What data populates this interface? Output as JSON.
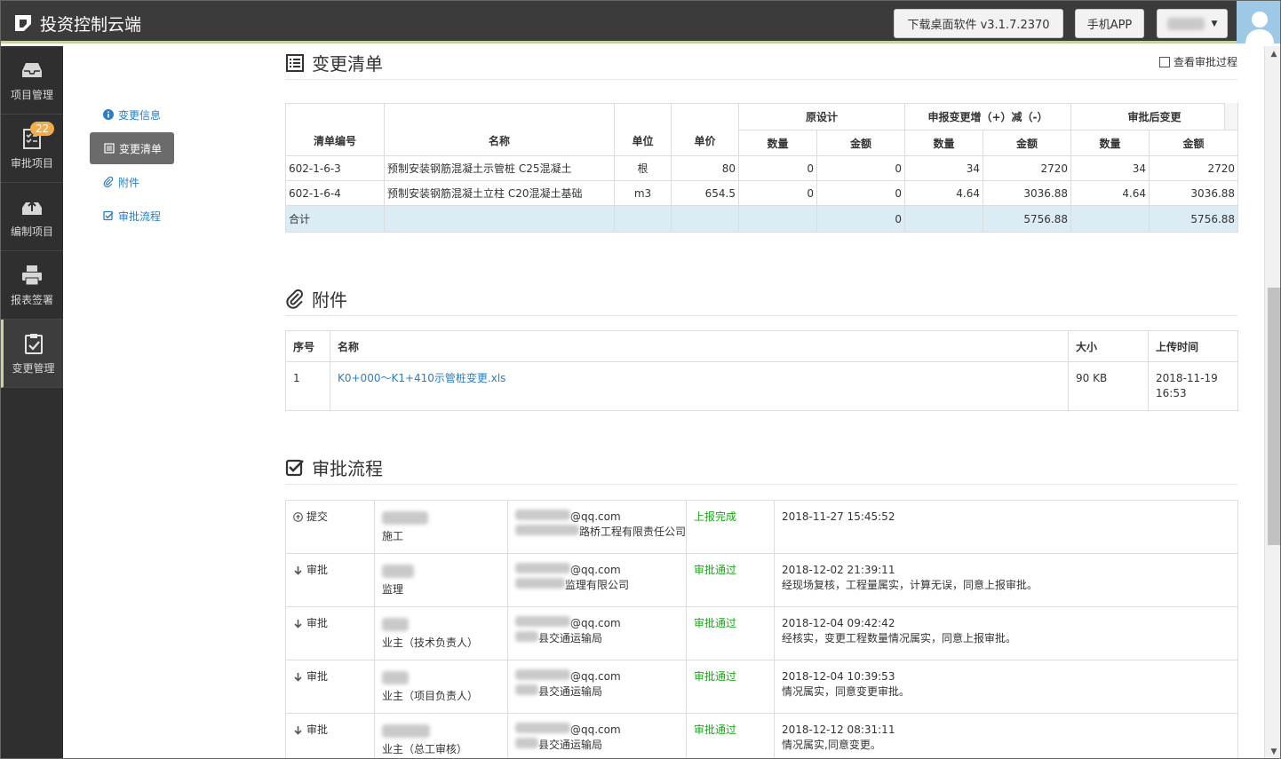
{
  "app": {
    "title": "投资控制云端"
  },
  "topbar": {
    "download_label": "下载桌面软件 v3.1.7.2370",
    "app_label": "手机APP"
  },
  "sidebar": {
    "items": [
      {
        "label": "项目管理",
        "icon": "inbox-icon"
      },
      {
        "label": "审批项目",
        "icon": "checklist-icon",
        "badge": "22"
      },
      {
        "label": "编制项目",
        "icon": "upload-icon"
      },
      {
        "label": "报表签署",
        "icon": "printer-icon"
      },
      {
        "label": "变更管理",
        "icon": "clipboard-icon",
        "active": true
      }
    ]
  },
  "subnav": {
    "items": [
      {
        "label": "变更信息"
      },
      {
        "label": "变更清单",
        "active": true
      },
      {
        "label": "附件"
      },
      {
        "label": "审批流程"
      }
    ]
  },
  "change_list": {
    "title": "变更清单",
    "view_process_label": "查看审批过程",
    "headers": {
      "code": "清单编号",
      "name": "名称",
      "unit": "单位",
      "price": "单价",
      "orig": "原设计",
      "report": "申报变更增（+）减（-）",
      "approved": "审批后变更",
      "qty": "数量",
      "amount": "金额"
    },
    "rows": [
      {
        "code": "602-1-6-3",
        "name": "预制安装钢筋混凝土示管桩 C25混凝土",
        "unit": "根",
        "price": "80",
        "orig_qty": "0",
        "orig_amt": "0",
        "rep_qty": "34",
        "rep_amt": "2720",
        "app_qty": "34",
        "app_amt": "2720"
      },
      {
        "code": "602-1-6-4",
        "name": "预制安装钢筋混凝土立柱 C20混凝土基础",
        "unit": "m3",
        "price": "654.5",
        "orig_qty": "0",
        "orig_amt": "0",
        "rep_qty": "4.64",
        "rep_amt": "3036.88",
        "app_qty": "4.64",
        "app_amt": "3036.88"
      }
    ],
    "total": {
      "label": "合计",
      "orig_amt": "0",
      "rep_amt": "5756.88",
      "app_amt": "5756.88"
    }
  },
  "attachments": {
    "title": "附件",
    "headers": {
      "no": "序号",
      "name": "名称",
      "size": "大小",
      "time": "上传时间"
    },
    "rows": [
      {
        "no": "1",
        "name": "K0+000～K1+410示管桩变更.xls",
        "size": "90 KB",
        "time": "2018-11-19 16:53"
      }
    ]
  },
  "process": {
    "title": "审批流程",
    "rows": [
      {
        "action": "提交",
        "role": "施工",
        "email": "@qq.com",
        "org": "路桥工程有限责任公司",
        "status": "上报完成",
        "time": "2018-11-27 15:45:52",
        "comment": ""
      },
      {
        "action": "审批",
        "role": "监理",
        "email": "@qq.com",
        "org": "监理有限公司",
        "status": "审批通过",
        "time": "2018-12-02 21:39:11",
        "comment": "经现场复核，工程量属实，计算无误，同意上报审批。"
      },
      {
        "action": "审批",
        "role": "业主（技术负责人）",
        "email": "@qq.com",
        "org": "县交通运输局",
        "status": "审批通过",
        "time": "2018-12-04 09:42:42",
        "comment": "经核实，变更工程数量情况属实，同意上报审批。"
      },
      {
        "action": "审批",
        "role": "业主（项目负责人）",
        "email": "@qq.com",
        "org": "县交通运输局",
        "status": "审批通过",
        "time": "2018-12-04 10:39:53",
        "comment": "情况属实，同意变更审批。"
      },
      {
        "action": "审批",
        "role": "业主（总工审核）",
        "email": "@qq.com",
        "org": "县交通运输局",
        "status": "审批通过",
        "time": "2018-12-12 08:31:11",
        "comment": "情况属实,同意变更。"
      }
    ]
  },
  "colors": {
    "accent": "#2a7ec4",
    "topbar": "#3b3b3b",
    "sidebar": "#2f2f2f",
    "success": "#1aa81a",
    "total_row": "#dcecf5"
  }
}
